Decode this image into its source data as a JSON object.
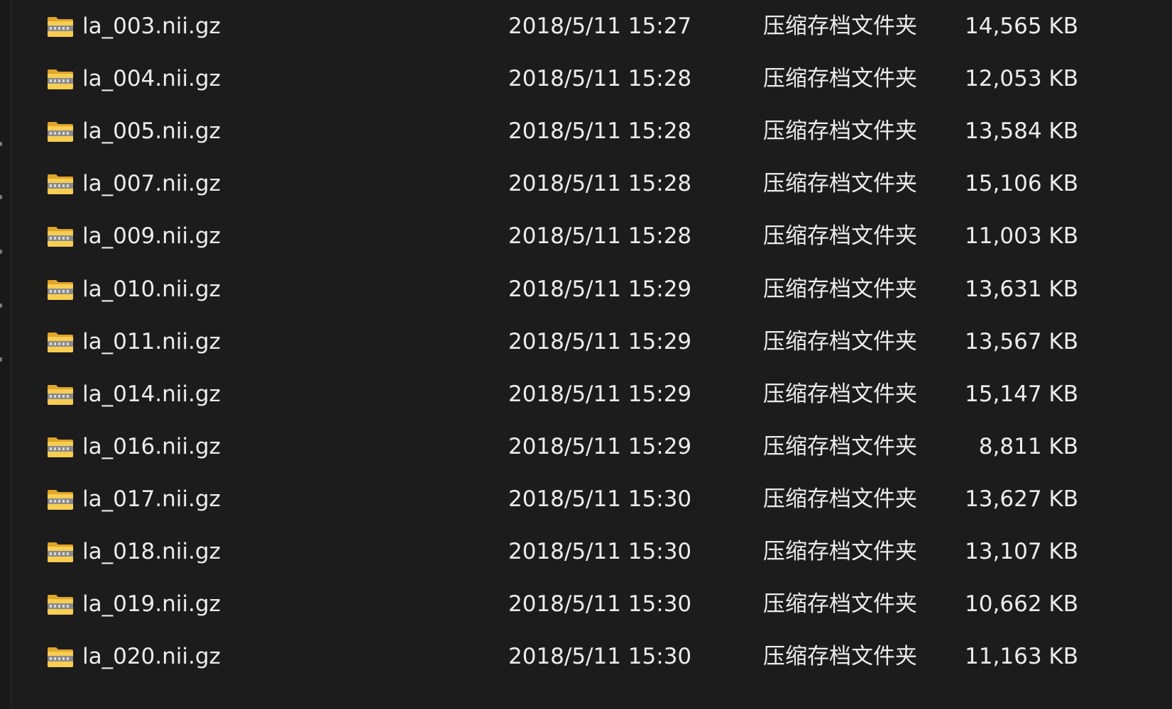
{
  "file_list": {
    "type_label": "压缩存档文件夹",
    "icon": "zip-folder-icon",
    "rows": [
      {
        "name": "la_003.nii.gz",
        "date": "2018/5/11 15:27",
        "size": "14,565 KB"
      },
      {
        "name": "la_004.nii.gz",
        "date": "2018/5/11 15:28",
        "size": "12,053 KB"
      },
      {
        "name": "la_005.nii.gz",
        "date": "2018/5/11 15:28",
        "size": "13,584 KB"
      },
      {
        "name": "la_007.nii.gz",
        "date": "2018/5/11 15:28",
        "size": "15,106 KB"
      },
      {
        "name": "la_009.nii.gz",
        "date": "2018/5/11 15:28",
        "size": "11,003 KB"
      },
      {
        "name": "la_010.nii.gz",
        "date": "2018/5/11 15:29",
        "size": "13,631 KB"
      },
      {
        "name": "la_011.nii.gz",
        "date": "2018/5/11 15:29",
        "size": "13,567 KB"
      },
      {
        "name": "la_014.nii.gz",
        "date": "2018/5/11 15:29",
        "size": "15,147 KB"
      },
      {
        "name": "la_016.nii.gz",
        "date": "2018/5/11 15:29",
        "size": "8,811 KB"
      },
      {
        "name": "la_017.nii.gz",
        "date": "2018/5/11 15:30",
        "size": "13,627 KB"
      },
      {
        "name": "la_018.nii.gz",
        "date": "2018/5/11 15:30",
        "size": "13,107 KB"
      },
      {
        "name": "la_019.nii.gz",
        "date": "2018/5/11 15:30",
        "size": "10,662 KB"
      },
      {
        "name": "la_020.nii.gz",
        "date": "2018/5/11 15:30",
        "size": "11,163 KB"
      }
    ]
  },
  "colors": {
    "background": "#1c1c1c",
    "text": "#ececec",
    "folder_yellow": "#f7cd52",
    "zipper": "#8a8a8a"
  }
}
